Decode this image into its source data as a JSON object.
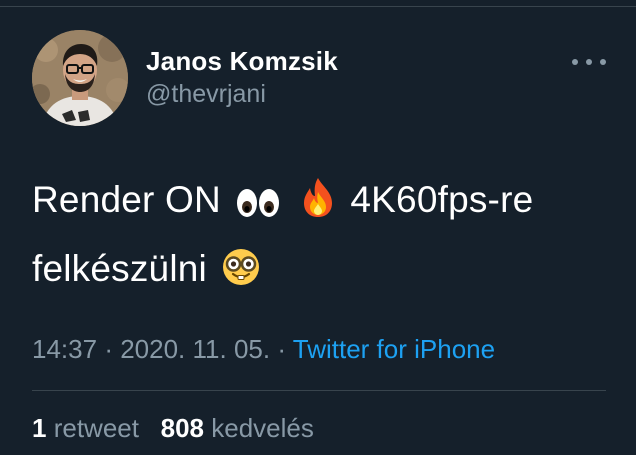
{
  "tweet": {
    "author": {
      "name": "Janos Komzsik",
      "handle": "@thevrjani"
    },
    "text": {
      "part1": "Render ON",
      "part2": "4K60fps-re",
      "part3": "felkészülni",
      "emojis": [
        "eyes-emoji",
        "fire-emoji",
        "nerd-face-emoji"
      ]
    },
    "meta": {
      "time": "14:37",
      "sep1": "·",
      "date": "2020. 11. 05.",
      "sep2": "·",
      "source": "Twitter for iPhone"
    },
    "stats": {
      "retweets_count": "1",
      "retweets_label": "retweet",
      "likes_count": "808",
      "likes_label": "kedvelés"
    }
  },
  "colors": {
    "background": "#15202b",
    "text_primary": "#ffffff",
    "text_secondary": "#8899a6",
    "link": "#1da1f2",
    "divider": "#38444d"
  }
}
